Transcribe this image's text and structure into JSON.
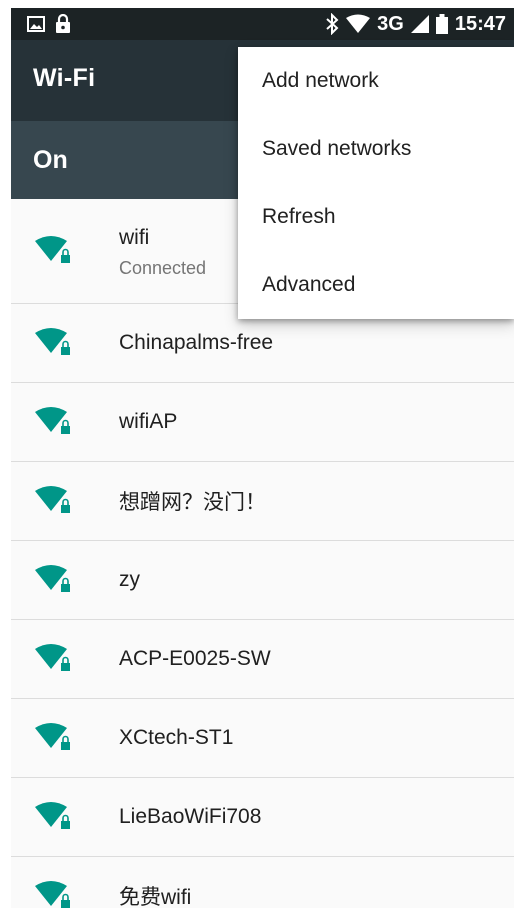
{
  "status_bar": {
    "icons_left": [
      "image-icon",
      "lock-icon"
    ],
    "icons_right": [
      "bluetooth-icon",
      "wifi-signal-icon",
      "cell-signal-icon",
      "battery-icon"
    ],
    "network_type": "3G",
    "time": "15:47"
  },
  "app_bar": {
    "title": "Wi-Fi"
  },
  "wifi_switch": {
    "label": "On",
    "state": true
  },
  "networks": [
    {
      "ssid": "wifi",
      "status": "Connected",
      "secured": true
    },
    {
      "ssid": "Chinapalms-free",
      "secured": true
    },
    {
      "ssid": "wifiAP",
      "secured": true
    },
    {
      "ssid": "想蹭网？没门！",
      "secured": true
    },
    {
      "ssid": "zy",
      "secured": true
    },
    {
      "ssid": "ACP-E0025-SW",
      "secured": true
    },
    {
      "ssid": "XCtech-ST1",
      "secured": true
    },
    {
      "ssid": "LieBaoWiFi708",
      "secured": true
    },
    {
      "ssid": "免费wifi",
      "secured": true
    }
  ],
  "overflow_menu": {
    "items": [
      "Add network",
      "Saved networks",
      "Refresh",
      "Advanced"
    ]
  },
  "colors": {
    "accent": "#009688",
    "status_bar": "#1c2325",
    "app_bar": "#263238",
    "switch_bar": "#37474f"
  }
}
